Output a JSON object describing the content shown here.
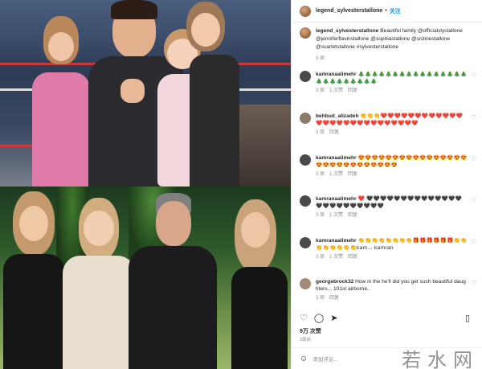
{
  "header": {
    "username": "legend_sylvesterstallone",
    "separator": "•",
    "follow_label": "关注"
  },
  "caption": {
    "username": "legend_sylvesterstallone",
    "text": "Beautiful family @officialslystallone @jenniferflavinstallone @sophiastallone @sistinestallone @scarletstallone #sylvesterstallone",
    "time": "3 周"
  },
  "comments": [
    {
      "username": "kamranaalimehr",
      "text": "🎄🎄🎄🎄🎄🎄🎄🎄🎄🎄🎄🎄🎄🎄🎄🎄🎄🎄🎄🎄🎄🎄🎄🎄🎄",
      "time": "3 周",
      "likes": "1 次赞",
      "reply": "回复"
    },
    {
      "username": "behbud_alizadeh",
      "text": "👏👏👏❤️❤️❤️❤️❤️❤️❤️❤️❤️❤️❤️❤️❤️❤️❤️❤️❤️❤️❤️❤️❤️❤️❤️❤️❤️❤️❤️",
      "time": "3 周",
      "likes": "",
      "reply": "回复"
    },
    {
      "username": "kamranaalimehr",
      "text": "😍😍😍😍😍😍😍😍😍😍😍😍😍😍😍😍😍😍😍😍😍😍😍😍😍😍😍😍",
      "time": "3 周",
      "likes": "1 次赞",
      "reply": "回复"
    },
    {
      "username": "kamranaalimehr",
      "text": "❤️ 🖤🖤🖤🖤🖤🖤🖤🖤🖤🖤🖤🖤🖤🖤🖤🖤🖤🖤🖤🖤🖤🖤🖤🖤",
      "time": "3 周",
      "likes": "1 次赞",
      "reply": "回复"
    },
    {
      "username": "kamranaalimehr",
      "text": "👏👏👏👏👏👏👏👏🎁🎁🎁🎁🎁🎁👏👏👏👏👏👏👏👏kam... kamran",
      "time": "3 周",
      "likes": "1 次赞",
      "reply": "回复"
    },
    {
      "username": "georgebrock32",
      "text": "How in the he'll did you get such beautiful daughters... 101st airborne..",
      "time": "3 周",
      "likes": "",
      "reply": "回复"
    }
  ],
  "stats": {
    "likes": "9万 次赞",
    "ago": "3周前"
  },
  "add_comment": {
    "placeholder": "添加评论..."
  },
  "watermark": "若水网",
  "colors": {
    "follow_blue": "#0095f6",
    "muted": "#8e8e8e"
  }
}
